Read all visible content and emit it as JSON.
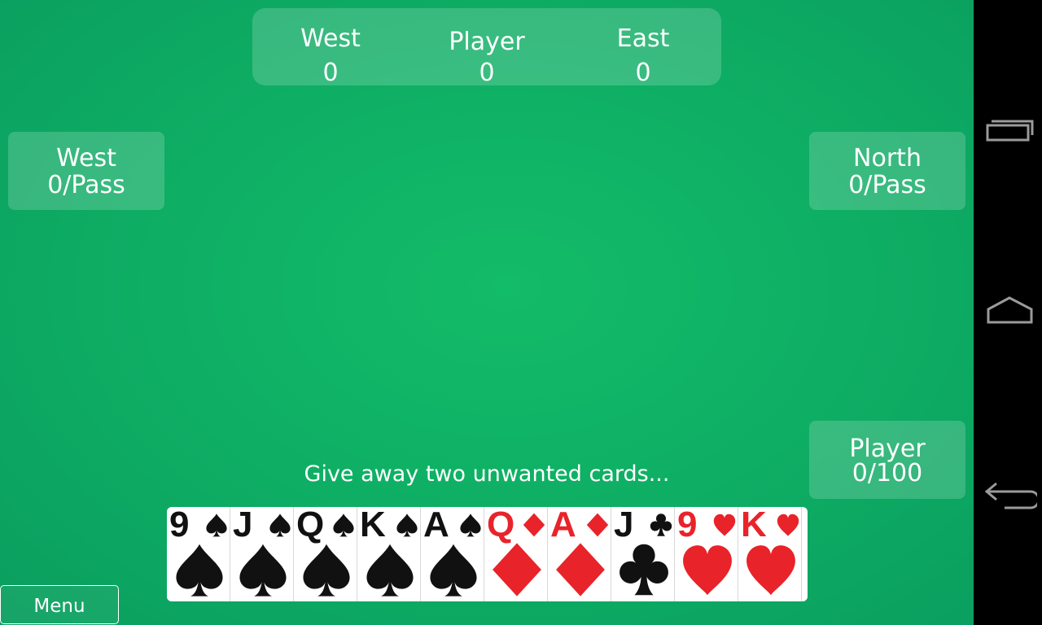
{
  "scoreboard": {
    "west": {
      "name": "West",
      "score": "0"
    },
    "player": {
      "name": "Player",
      "score": "0"
    },
    "east": {
      "name": "East",
      "score": "0"
    }
  },
  "seats": {
    "west": {
      "name": "West",
      "status": "0/Pass"
    },
    "north": {
      "name": "North",
      "status": "0/Pass"
    },
    "player": {
      "name": "Player",
      "status": "0/100"
    }
  },
  "instruction": "Give away two unwanted cards...",
  "hand": [
    {
      "rank": "9",
      "suit": "spades",
      "color": "#111111"
    },
    {
      "rank": "J",
      "suit": "spades",
      "color": "#111111"
    },
    {
      "rank": "Q",
      "suit": "spades",
      "color": "#111111"
    },
    {
      "rank": "K",
      "suit": "spades",
      "color": "#111111"
    },
    {
      "rank": "A",
      "suit": "spades",
      "color": "#111111"
    },
    {
      "rank": "Q",
      "suit": "diamonds",
      "color": "#e8232a"
    },
    {
      "rank": "A",
      "suit": "diamonds",
      "color": "#e8232a"
    },
    {
      "rank": "J",
      "suit": "clubs",
      "color": "#111111"
    },
    {
      "rank": "9",
      "suit": "hearts",
      "color": "#e8232a"
    },
    {
      "rank": "K",
      "suit": "hearts",
      "color": "#e8232a"
    }
  ],
  "menu": {
    "label": "Menu"
  },
  "navbar": {
    "recent_icon": "recent-apps-icon",
    "home_icon": "home-icon",
    "back_icon": "back-icon"
  },
  "colors": {
    "felt": "#0fb165",
    "red_suit": "#e8232a",
    "black_suit": "#111111"
  }
}
